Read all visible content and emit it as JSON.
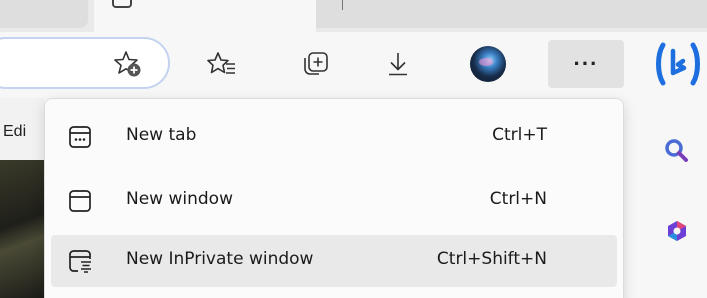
{
  "sidebar_left": {
    "partial_label": "Edi"
  },
  "menu": {
    "items": [
      {
        "label": "New tab",
        "shortcut": "Ctrl+T",
        "icon": "new-tab-icon"
      },
      {
        "label": "New window",
        "shortcut": "Ctrl+N",
        "icon": "new-window-icon"
      },
      {
        "label": "New InPrivate window",
        "shortcut": "Ctrl+Shift+N",
        "icon": "inprivate-window-icon"
      }
    ]
  },
  "toolbar": {
    "more_label": "···",
    "icons": [
      "add-favorite-icon",
      "favorites-icon",
      "collections-icon",
      "downloads-icon",
      "profile-avatar",
      "more-icon",
      "bing-copilot-icon"
    ]
  },
  "right_sidebar": {
    "icons": [
      "search-icon",
      "office-icon"
    ]
  },
  "colors": {
    "bing_blue": "#1d6fe0",
    "hover_bg": "#e9e9e9"
  }
}
